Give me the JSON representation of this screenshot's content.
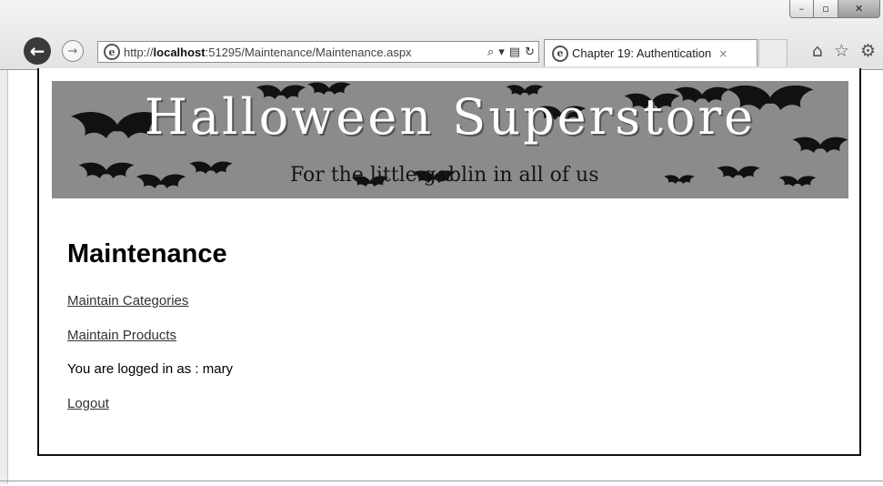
{
  "window": {
    "minimize_glyph": "–",
    "maximize_glyph": "▫",
    "close_glyph": "✕"
  },
  "browser": {
    "url_prefix": "http://",
    "url_host": "localhost",
    "url_rest": ":51295/Maintenance/Maintenance.aspx",
    "tab_title": "Chapter 19: Authentication",
    "tab_close_glyph": "×",
    "icons": {
      "back": "back-arrow-icon",
      "forward": "forward-arrow-icon",
      "page": "ie-page-icon",
      "search": "search-icon",
      "dropdown": "dropdown-arrow-icon",
      "compat": "compatibility-view-icon",
      "refresh": "refresh-icon",
      "home": "home-icon",
      "favorites": "star-icon",
      "tools": "gear-icon"
    }
  },
  "page": {
    "banner": {
      "title": "Halloween Superstore",
      "tagline": "For the little goblin in all of us"
    },
    "heading": "Maintenance",
    "links": {
      "categories": "Maintain Categories",
      "products": "Maintain Products",
      "logout": "Logout"
    },
    "status": "You are logged in as : mary"
  },
  "colors": {
    "banner_bg": "#8b8b8b",
    "banner_title": "#ffffff",
    "link": "#333333"
  }
}
